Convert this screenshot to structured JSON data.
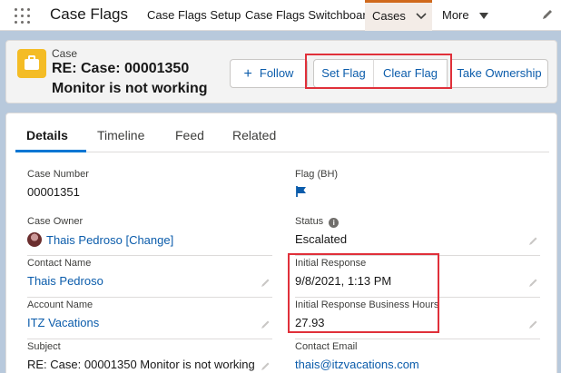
{
  "nav": {
    "app_name": "Case Flags",
    "tabs": [
      {
        "label": "Case Flags Setup"
      },
      {
        "label": "Case Flags Switchboard"
      },
      {
        "label": "Cases"
      },
      {
        "label": "More"
      }
    ],
    "accent_color": "#d0691c"
  },
  "header": {
    "entity_label": "Case",
    "title_line1": "RE: Case: 00001350",
    "title_line2": "Monitor is not working",
    "icon": "briefcase-icon",
    "icon_color": "#f4bc25",
    "buttons": {
      "follow": "Follow",
      "set_flag": "Set Flag",
      "clear_flag": "Clear Flag",
      "take_ownership": "Take Ownership"
    }
  },
  "detail_tabs": [
    {
      "label": "Details"
    },
    {
      "label": "Timeline"
    },
    {
      "label": "Feed"
    },
    {
      "label": "Related"
    }
  ],
  "fields": {
    "case_number": {
      "label": "Case Number",
      "value": "00001351"
    },
    "flag": {
      "label": "Flag (BH)",
      "icon": "flag-icon",
      "color": "#0b5cab"
    },
    "case_owner": {
      "label": "Case Owner",
      "value": "Thais Pedroso",
      "action": "[Change]"
    },
    "status": {
      "label": "Status",
      "value": "Escalated"
    },
    "contact_name": {
      "label": "Contact Name",
      "value": "Thais Pedroso"
    },
    "initial_response": {
      "label": "Initial Response",
      "value": "9/8/2021, 1:13 PM"
    },
    "account_name": {
      "label": "Account Name",
      "value": "ITZ Vacations"
    },
    "initial_response_bh": {
      "label": "Initial Response Business Hours",
      "value": "27.93"
    },
    "subject": {
      "label": "Subject",
      "value": "RE: Case: 00001350 Monitor is not working"
    },
    "contact_email": {
      "label": "Contact Email",
      "value": "thais@itzvacations.com"
    }
  },
  "annotation_color": "#e0303a"
}
